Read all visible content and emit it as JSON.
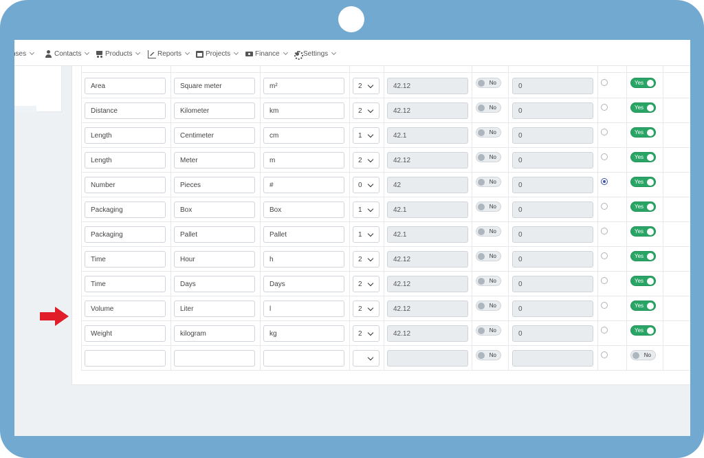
{
  "nav": [
    {
      "label": "nses",
      "icon": ""
    },
    {
      "label": "Contacts",
      "icon": "user-icon"
    },
    {
      "label": "Products",
      "icon": "cart-icon"
    },
    {
      "label": "Reports",
      "icon": "chart-icon"
    },
    {
      "label": "Projects",
      "icon": "calendar-icon"
    },
    {
      "label": "Finance",
      "icon": "money-icon"
    },
    {
      "label": "Settings",
      "icon": "gear-icon"
    }
  ],
  "colors": {
    "frame": "#72a9d0",
    "toggle_on": "#2aa566",
    "radio_checked": "#3f51b5",
    "arrow": "#e11d2a"
  },
  "rows": [
    {
      "category": "Area",
      "unit": "Square meter",
      "symbol": "m²",
      "decimals": "2",
      "example": "42.12",
      "toggle1": "No",
      "value": "0",
      "default": false,
      "active": "Yes"
    },
    {
      "category": "Distance",
      "unit": "Kilometer",
      "symbol": "km",
      "decimals": "2",
      "example": "42.12",
      "toggle1": "No",
      "value": "0",
      "default": false,
      "active": "Yes"
    },
    {
      "category": "Length",
      "unit": "Centimeter",
      "symbol": "cm",
      "decimals": "1",
      "example": "42.1",
      "toggle1": "No",
      "value": "0",
      "default": false,
      "active": "Yes"
    },
    {
      "category": "Length",
      "unit": "Meter",
      "symbol": "m",
      "decimals": "2",
      "example": "42.12",
      "toggle1": "No",
      "value": "0",
      "default": false,
      "active": "Yes"
    },
    {
      "category": "Number",
      "unit": "Pieces",
      "symbol": "#",
      "decimals": "0",
      "example": "42",
      "toggle1": "No",
      "value": "0",
      "default": true,
      "active": "Yes"
    },
    {
      "category": "Packaging",
      "unit": "Box",
      "symbol": "Box",
      "decimals": "1",
      "example": "42.1",
      "toggle1": "No",
      "value": "0",
      "default": false,
      "active": "Yes"
    },
    {
      "category": "Packaging",
      "unit": "Pallet",
      "symbol": "Pallet",
      "decimals": "1",
      "example": "42.1",
      "toggle1": "No",
      "value": "0",
      "default": false,
      "active": "Yes"
    },
    {
      "category": "Time",
      "unit": "Hour",
      "symbol": "h",
      "decimals": "2",
      "example": "42.12",
      "toggle1": "No",
      "value": "0",
      "default": false,
      "active": "Yes"
    },
    {
      "category": "Time",
      "unit": "Days",
      "symbol": "Days",
      "decimals": "2",
      "example": "42.12",
      "toggle1": "No",
      "value": "0",
      "default": false,
      "active": "Yes"
    },
    {
      "category": "Volume",
      "unit": "Liter",
      "symbol": "l",
      "decimals": "2",
      "example": "42.12",
      "toggle1": "No",
      "value": "0",
      "default": false,
      "active": "Yes"
    },
    {
      "category": "Weight",
      "unit": "kilogram",
      "symbol": "kg",
      "decimals": "2",
      "example": "42.12",
      "toggle1": "No",
      "value": "0",
      "default": false,
      "active": "Yes"
    },
    {
      "category": "",
      "unit": "",
      "symbol": "",
      "decimals": "",
      "example": "",
      "toggle1": "No",
      "value": "",
      "default": false,
      "active": "No"
    }
  ]
}
